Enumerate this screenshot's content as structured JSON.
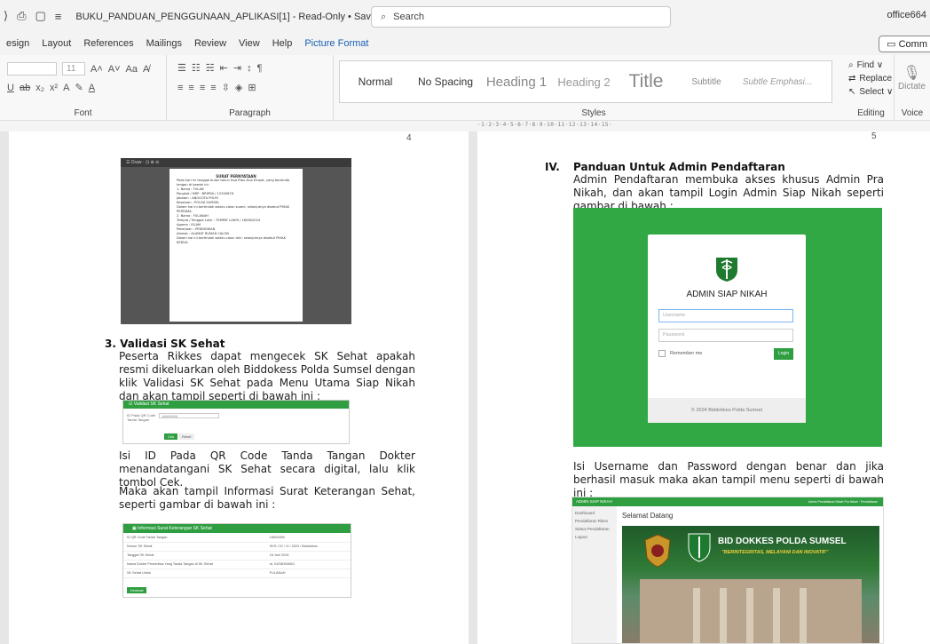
{
  "titlebar": {
    "title": "BUKU_PANDUAN_PENGGUNAAN_APLIKASI[1]  -  Read-Only • Saved ∨",
    "search_placeholder": "Search",
    "user": "office664"
  },
  "menubar": {
    "tabs": [
      "esign",
      "Layout",
      "References",
      "Mailings",
      "Review",
      "View",
      "Help",
      "Picture Format"
    ],
    "comments": "Comm"
  },
  "ribbon": {
    "font_size": "11",
    "group_font": "Font",
    "group_paragraph": "Paragraph",
    "group_styles": "Styles",
    "group_editing": "Editing",
    "group_voice": "Voice",
    "styles": [
      "Normal",
      "No Spacing",
      "Heading 1",
      "Heading 2",
      "Title",
      "Subtitle",
      "Subtle Emphasi..."
    ],
    "editing": [
      "Find ∨",
      "Replace",
      "Select ∨"
    ],
    "dictate": "Dictate"
  },
  "ruler": {
    "marks": "·1·2·3·4·5·6·7·8·9·10·11·12·13·14·15·"
  },
  "left_page": {
    "page_number": "4",
    "letter": {
      "title": "SURAT PERNYATAAN",
      "intro": "Pada hari ini tanggal bulan tahun Dua Ribu Dua Empat, yang bertanda tangan di bawah ini:",
      "lines": [
        "1. Nama : FULAN",
        "Pangkat / NRP : BRIPDA / 12345678",
        "Jabatan : ANGGOTA POLRI",
        "Kesatuan : POLDA SUMSEL",
        "Dalam hal ini bertindak selaku calon suami, selanjutnya disebut PIHAK PERTAMA.",
        "2. Nama : FULANAH",
        "Tempat / Tanggal Lahir : TEMPAT LAHIR / 16/08/2024",
        "Agama : ISLAM",
        "Pekerjaan : PENDIDIKAN",
        "Alamat : ALAMAT RUMAH CALON",
        "Dalam hal ini bertindak selaku calon istri, selanjutnya disebut PIHAK KEDUA."
      ]
    },
    "section3": {
      "heading": "3.  Validasi SK Sehat",
      "para1": "Peserta Rikkes dapat mengecek SK Sehat apakah resmi dikeluarkan oleh Biddokess Polda Sumsel dengan klik Validasi SK Sehat pada Menu Utama Siap Nikah dan akan tampil seperti di bawah ini :",
      "para2": "Isi ID Pada QR Code Tanda Tangan Dokter menandatangani SK Sehat secara digital, lalu klik tombol Cek.",
      "para3": "Maka akan tampil Informasi Surat Keterangan Sehat, seperti gambar di bawah ini :"
    },
    "validasi": {
      "header": "Validasi SK Sehat",
      "label": "ID Pada QR Code Tanda Tangan",
      "value": "16604966",
      "btn_cek": "Cek",
      "btn_reset": "Reset"
    },
    "informasi": {
      "header": "Informasi Surat Keterangan SK Sehat",
      "rows": [
        [
          "ID QR Code Tanda Tangan",
          "16604966"
        ],
        [
          "Nomor SK Sehat",
          "SKS / 22 / VI / 2024 / Biddokkes"
        ],
        [
          "Tanggal SK Sehat",
          "18 Juni 2024"
        ],
        [
          "Nama Dokter Pemeriksa Yang Tanda Tangan di SK Sehat",
          "dr. KATARANDO"
        ],
        [
          "SK Sehat Untuk",
          "FULANAH"
        ]
      ],
      "btn": "Kembali"
    }
  },
  "right_page": {
    "page_number": "5",
    "section4": {
      "roman": "IV.",
      "heading": "Panduan Untuk Admin Pendaftaran",
      "para1": "Admin Pendaftaran membuka akses khusus Admin Pra Nikah, dan akan tampil Login Admin Siap Nikah seperti gambar di bawah :",
      "para2": "Isi Username dan Password dengan benar dan jika berhasil masuk maka akan tampil menu seperti di bawah ini :"
    },
    "login": {
      "title": "ADMIN SIAP NIKAH",
      "username_ph": "Username",
      "password_ph": "Password",
      "remember": "Remember me",
      "btn": "Login",
      "footer": "© 2024 Biddokkes Polda Sumsel"
    },
    "dashboard": {
      "brand": "ADMIN SIAP NIKAH",
      "topright": "Admin Pendaftaran Nikah Pra Nikah · Pendaftaran",
      "menu": [
        "Dashboard",
        "Pendaftaran Rikes",
        "Status Pendaftaran",
        "Logout"
      ],
      "welcome": "Selamat Datang",
      "banner_title": "BID DOKKES POLDA SUMSEL",
      "banner_sub": "\"BERINTEGRITAS, MELAYANI DAN INOVATIF\""
    }
  },
  "colors": {
    "accent_green": "#2e9e40",
    "word_blue": "#1a5fb4"
  }
}
